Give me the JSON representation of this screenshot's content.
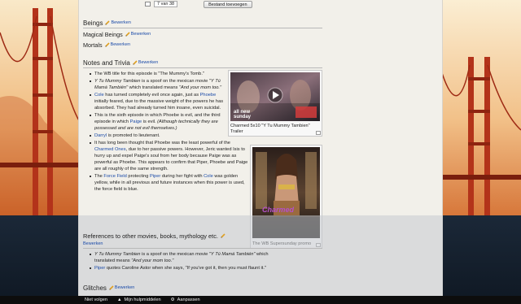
{
  "topnav": {
    "page_count": "7 van 38",
    "add_file_label": "Bestand toevoegen"
  },
  "edit_label": "Bewerken",
  "sections": {
    "beings": "Beings",
    "magical_beings": "Magical Beings",
    "mortals": "Mortals",
    "notes_trivia": "Notes and Trivia",
    "references": "References to other movies, books, mythology etc.",
    "glitches": "Glitches"
  },
  "trivia": {
    "b1": "The WB title for this episode is \"The Mummy's Tomb.\"",
    "b2_em": "Y Tu Mummy Tambien",
    "b2_text": " is a spoof on the mexican movie ",
    "b2_q": "\"Y Tú Mamá También\"",
    "b2_text2": " which translated means ",
    "b2_q2": "\"And your mom too.\"",
    "b3_link1": "Cole",
    "b3_text1": " has turned completely evil once again, just as ",
    "b3_link2": "Phoebe",
    "b3_text2": " initially feared, due to the massive weight of the powers he has absorbed. They had already turned him insane, even suicidal.",
    "b4_text1": "This is the sixth episode in which Phoebe is evil, and the third episode in which ",
    "b4_link": "Paige",
    "b4_text2": " is evil. ",
    "b4_em": "(Although technically they are possessed and are not evil themselves.)",
    "b5_link": "Darryl",
    "b5_text": " is promoted to lieutenant.",
    "b6_text1": "It has long been thought that Phoebe was the least powerful of the ",
    "b6_link": "Charmed Ones",
    "b6_text2": ", due to her passive powers. However, Jeric wanted Isis to hurry up and expel Paige's soul from her body because Paige was as powerful as Phoebe. This appears to confirm that Piper, Phoebe and Paige are all roughly of the same strength.",
    "b7_text1": "The ",
    "b7_link1": "Force Field",
    "b7_text2": " protecting ",
    "b7_link2": "Piper",
    "b7_text3": " during her fight with ",
    "b7_link3": "Cole",
    "b7_text4": " was golden yellow, while in all previous and future instances when this power is used, the force field is blue."
  },
  "thumbs": {
    "video_caption": "Charmed 5x10 \"Y Tu Mummy Tambien\" Trailer",
    "video_overlay": "all new sunday",
    "poster_caption": "The WB Supersunday promo",
    "poster_title": "Charmed"
  },
  "references": {
    "b1_em": "Y Tu Mummy Tambien",
    "b1_text": " is a spoof on the mexican movie ",
    "b1_q": "\"Y Tú Mamá También\"",
    "b1_text2": " which translated means ",
    "b1_q2": "\"And your mom too.\"",
    "b2_link": "Piper",
    "b2_text": " quotes Caroline Astor when she says, \"If you've got it, then you must flaunt it.\""
  },
  "toolbar": {
    "follow": "Niet volgen",
    "tools": "Mijn hulpmiddelen",
    "customize": "Aanpassen"
  },
  "colors": {
    "link": "#1a4aa8",
    "toolbar_bg": "#0d0d0d",
    "page_bg": "#f2f0ea"
  },
  "icons": [
    "pencil-icon",
    "play-icon",
    "magnify-icon",
    "tools-icon",
    "gear-icon"
  ]
}
